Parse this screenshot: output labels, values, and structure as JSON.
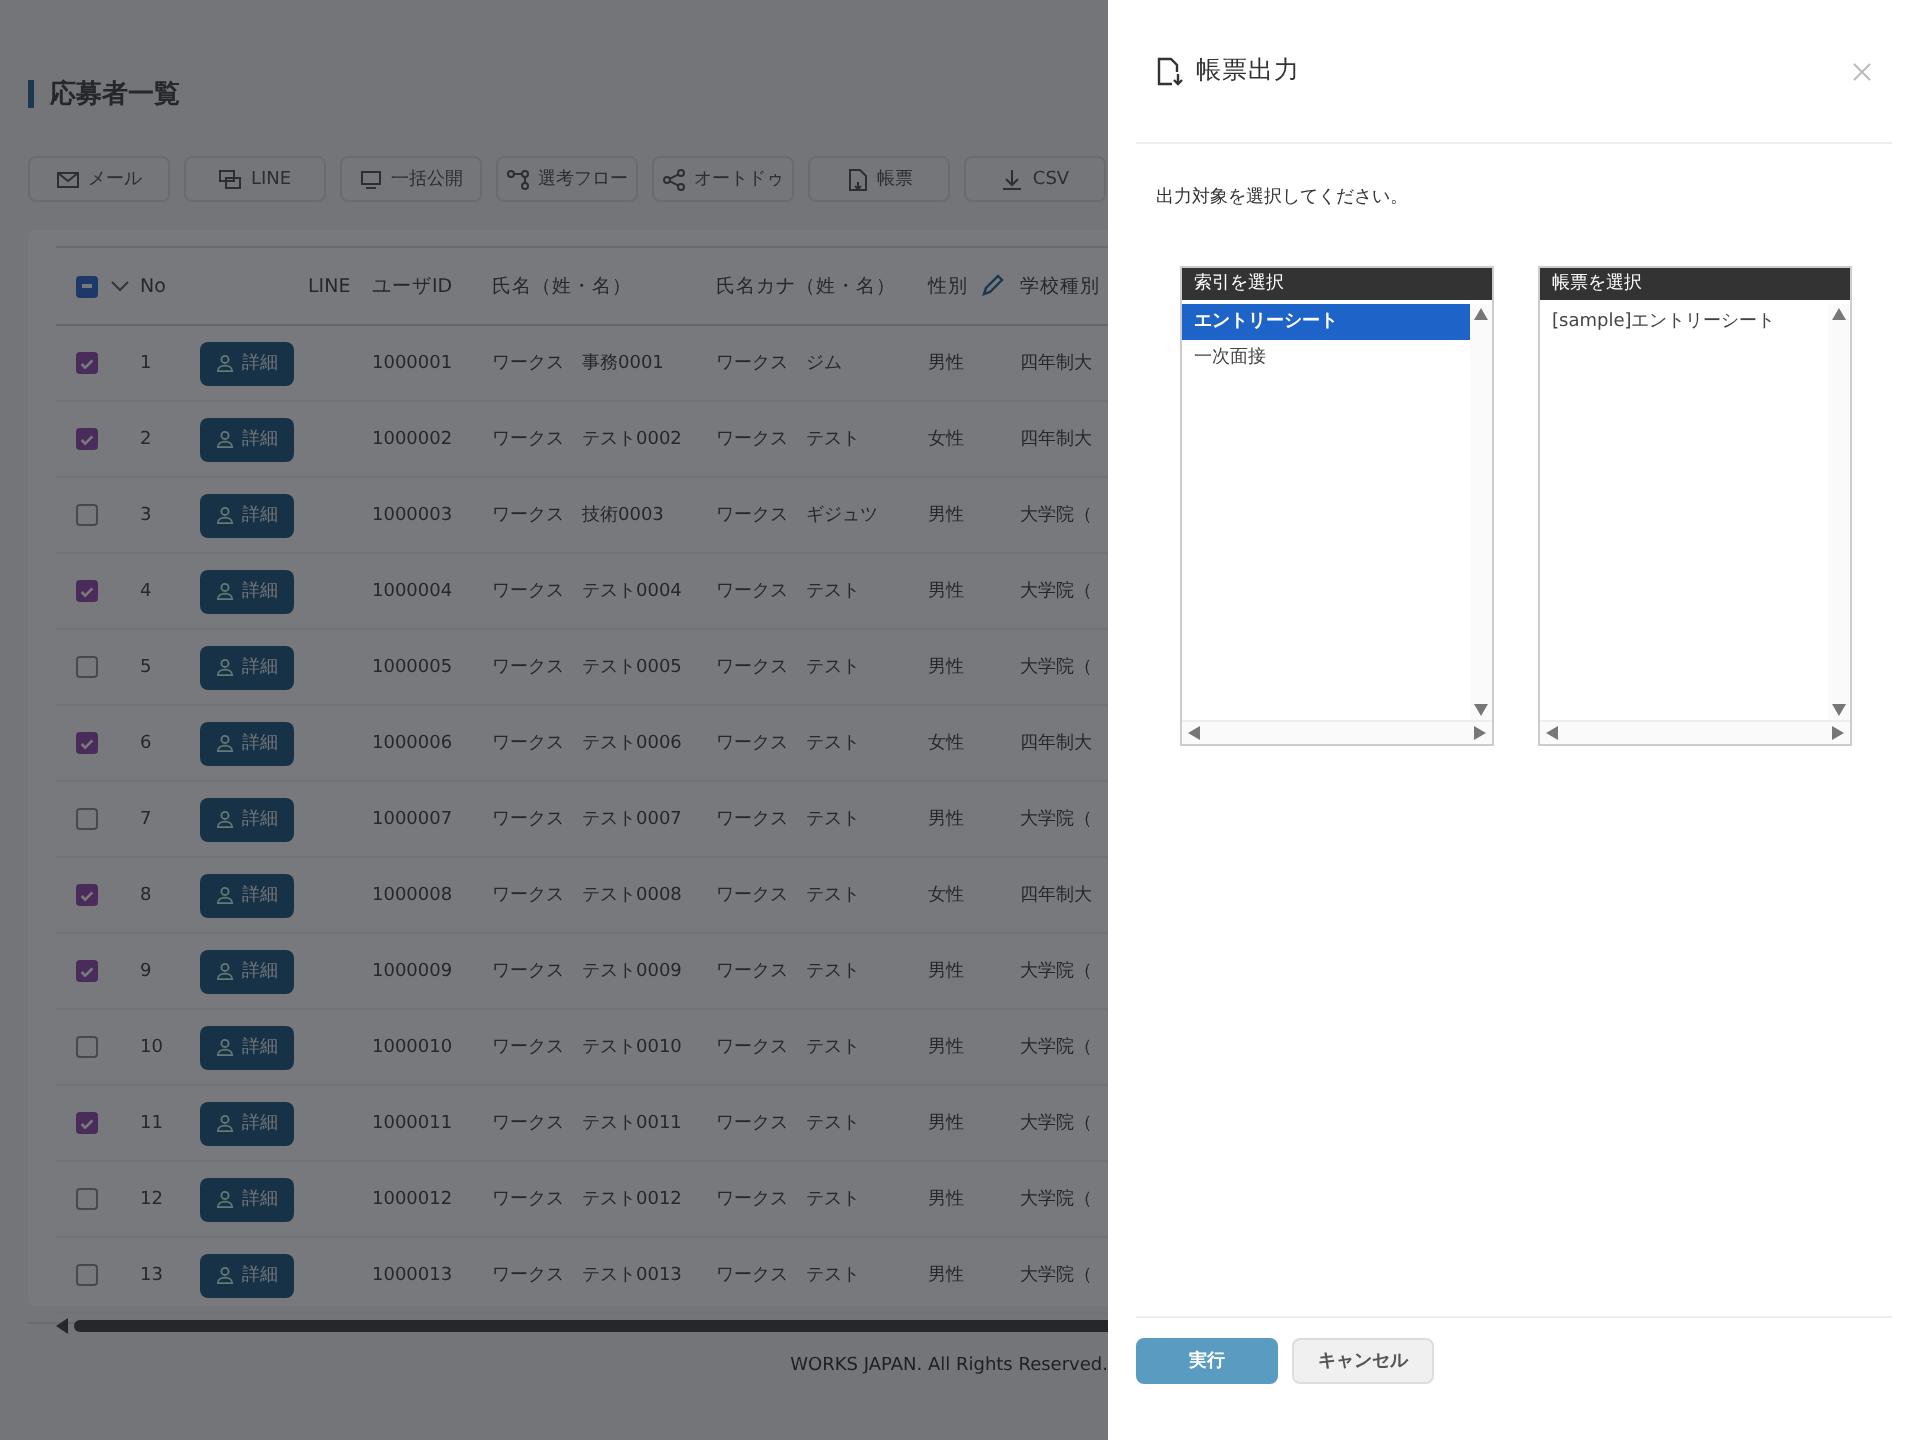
{
  "page": {
    "title": "応募者一覧",
    "toolbar": [
      {
        "label": "メール",
        "kind": "mail"
      },
      {
        "label": "LINE",
        "kind": "chat"
      },
      {
        "label": "一括公開",
        "kind": "publish"
      },
      {
        "label": "選考フロー",
        "kind": "flow"
      },
      {
        "label": "オートドゥ",
        "kind": "share"
      },
      {
        "label": "帳票",
        "kind": "doc"
      },
      {
        "label": "CSV",
        "kind": "download"
      }
    ],
    "table": {
      "columns": [
        "No",
        "LINE",
        "ユーザID",
        "氏名（姓・名）",
        "氏名カナ（姓・名）",
        "性別",
        "学校種別"
      ],
      "select_all": {
        "indeterminate": true
      },
      "rows_detail_label": [
        "詳細",
        "詳細",
        "詳細",
        "詳細",
        "詳細",
        "詳細",
        "詳細",
        "詳細",
        "詳細",
        "詳細",
        "詳細",
        "詳細",
        "詳細"
      ],
      "rows": [
        {
          "no": "1",
          "checked": true,
          "id": "1000001",
          "name": "ワークス　事務0001",
          "kana": "ワークス　ジム",
          "gender": "男性",
          "school": "四年制大"
        },
        {
          "no": "2",
          "checked": true,
          "id": "1000002",
          "name": "ワークス　テスト0002",
          "kana": "ワークス　テスト",
          "gender": "女性",
          "school": "四年制大"
        },
        {
          "no": "3",
          "checked": false,
          "id": "1000003",
          "name": "ワークス　技術0003",
          "kana": "ワークス　ギジュツ",
          "gender": "男性",
          "school": "大学院（"
        },
        {
          "no": "4",
          "checked": true,
          "id": "1000004",
          "name": "ワークス　テスト0004",
          "kana": "ワークス　テスト",
          "gender": "男性",
          "school": "大学院（"
        },
        {
          "no": "5",
          "checked": false,
          "id": "1000005",
          "name": "ワークス　テスト0005",
          "kana": "ワークス　テスト",
          "gender": "男性",
          "school": "大学院（"
        },
        {
          "no": "6",
          "checked": true,
          "id": "1000006",
          "name": "ワークス　テスト0006",
          "kana": "ワークス　テスト",
          "gender": "女性",
          "school": "四年制大"
        },
        {
          "no": "7",
          "checked": false,
          "id": "1000007",
          "name": "ワークス　テスト0007",
          "kana": "ワークス　テスト",
          "gender": "男性",
          "school": "大学院（"
        },
        {
          "no": "8",
          "checked": true,
          "id": "1000008",
          "name": "ワークス　テスト0008",
          "kana": "ワークス　テスト",
          "gender": "女性",
          "school": "四年制大"
        },
        {
          "no": "9",
          "checked": true,
          "id": "1000009",
          "name": "ワークス　テスト0009",
          "kana": "ワークス　テスト",
          "gender": "男性",
          "school": "大学院（"
        },
        {
          "no": "10",
          "checked": false,
          "id": "1000010",
          "name": "ワークス　テスト0010",
          "kana": "ワークス　テスト",
          "gender": "男性",
          "school": "大学院（"
        },
        {
          "no": "11",
          "checked": true,
          "id": "1000011",
          "name": "ワークス　テスト0011",
          "kana": "ワークス　テスト",
          "gender": "男性",
          "school": "大学院（"
        },
        {
          "no": "12",
          "checked": false,
          "id": "1000012",
          "name": "ワークス　テスト0012",
          "kana": "ワークス　テスト",
          "gender": "男性",
          "school": "大学院（"
        },
        {
          "no": "13",
          "checked": false,
          "id": "1000013",
          "name": "ワークス　テスト0013",
          "kana": "ワークス　テスト",
          "gender": "男性",
          "school": "大学院（"
        }
      ]
    },
    "footer": "WORKS JAPAN. All Rights Reserved."
  },
  "drawer": {
    "title": "帳票出力",
    "message": "出力対象を選択してください。",
    "lists": [
      {
        "header": "索引を選択",
        "items": [
          {
            "label": "エントリーシート",
            "selected": true
          },
          {
            "label": "一次面接",
            "selected": false
          }
        ]
      },
      {
        "header": "帳票を選択",
        "items": [
          {
            "label": "[sample]エントリーシート",
            "selected": false
          }
        ]
      }
    ],
    "buttons": [
      {
        "label": "実行",
        "kind": "primary"
      },
      {
        "label": "キャンセル",
        "kind": "secondary"
      }
    ]
  }
}
